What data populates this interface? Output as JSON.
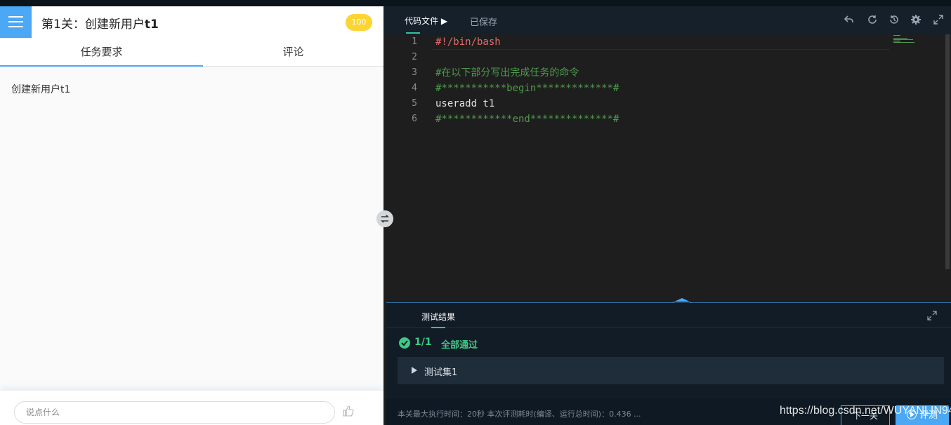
{
  "header": {
    "title_prefix": "第1关：创建新用户",
    "title_bold": "t1",
    "score": "100"
  },
  "left_tabs": [
    {
      "label": "任务要求",
      "active": true
    },
    {
      "label": "评论",
      "active": false
    }
  ],
  "task": {
    "description": "创建新用户t1"
  },
  "comment_box": {
    "placeholder": "说点什么"
  },
  "editor": {
    "file_tab": "代码文件 ▶",
    "save_status": "已保存",
    "toolbar_icons": [
      "undo-icon",
      "refresh-icon",
      "restore-icon",
      "settings-icon",
      "fullscreen-icon"
    ],
    "lines": [
      {
        "num": "1",
        "text": "#!/bin/bash",
        "kind": "shebang"
      },
      {
        "num": "2",
        "text": "",
        "kind": "cmd"
      },
      {
        "num": "3",
        "text": "#在以下部分写出完成任务的命令",
        "kind": "cmt"
      },
      {
        "num": "4",
        "text": "#***********begin*************#",
        "kind": "cmt"
      },
      {
        "num": "5",
        "text": "useradd t1",
        "kind": "cmd"
      },
      {
        "num": "6",
        "text": "#************end**************#",
        "kind": "cmt"
      }
    ]
  },
  "results": {
    "tab": "测试结果",
    "pass_count": "1/1",
    "pass_text": "全部通过",
    "test_set": "测试集1",
    "footer_info": "本关最大执行时间：20秒    本次评测耗时(编译、运行总时间)：0.436 ...",
    "button_outline": "下一关",
    "button_eval": "评测"
  },
  "watermark": "https://blog.csdn.net/WUYANLIN94",
  "colors": {
    "accent_blue": "#4aa8f5",
    "pass_green": "#3ec987",
    "score_yellow": "#fcd434"
  }
}
